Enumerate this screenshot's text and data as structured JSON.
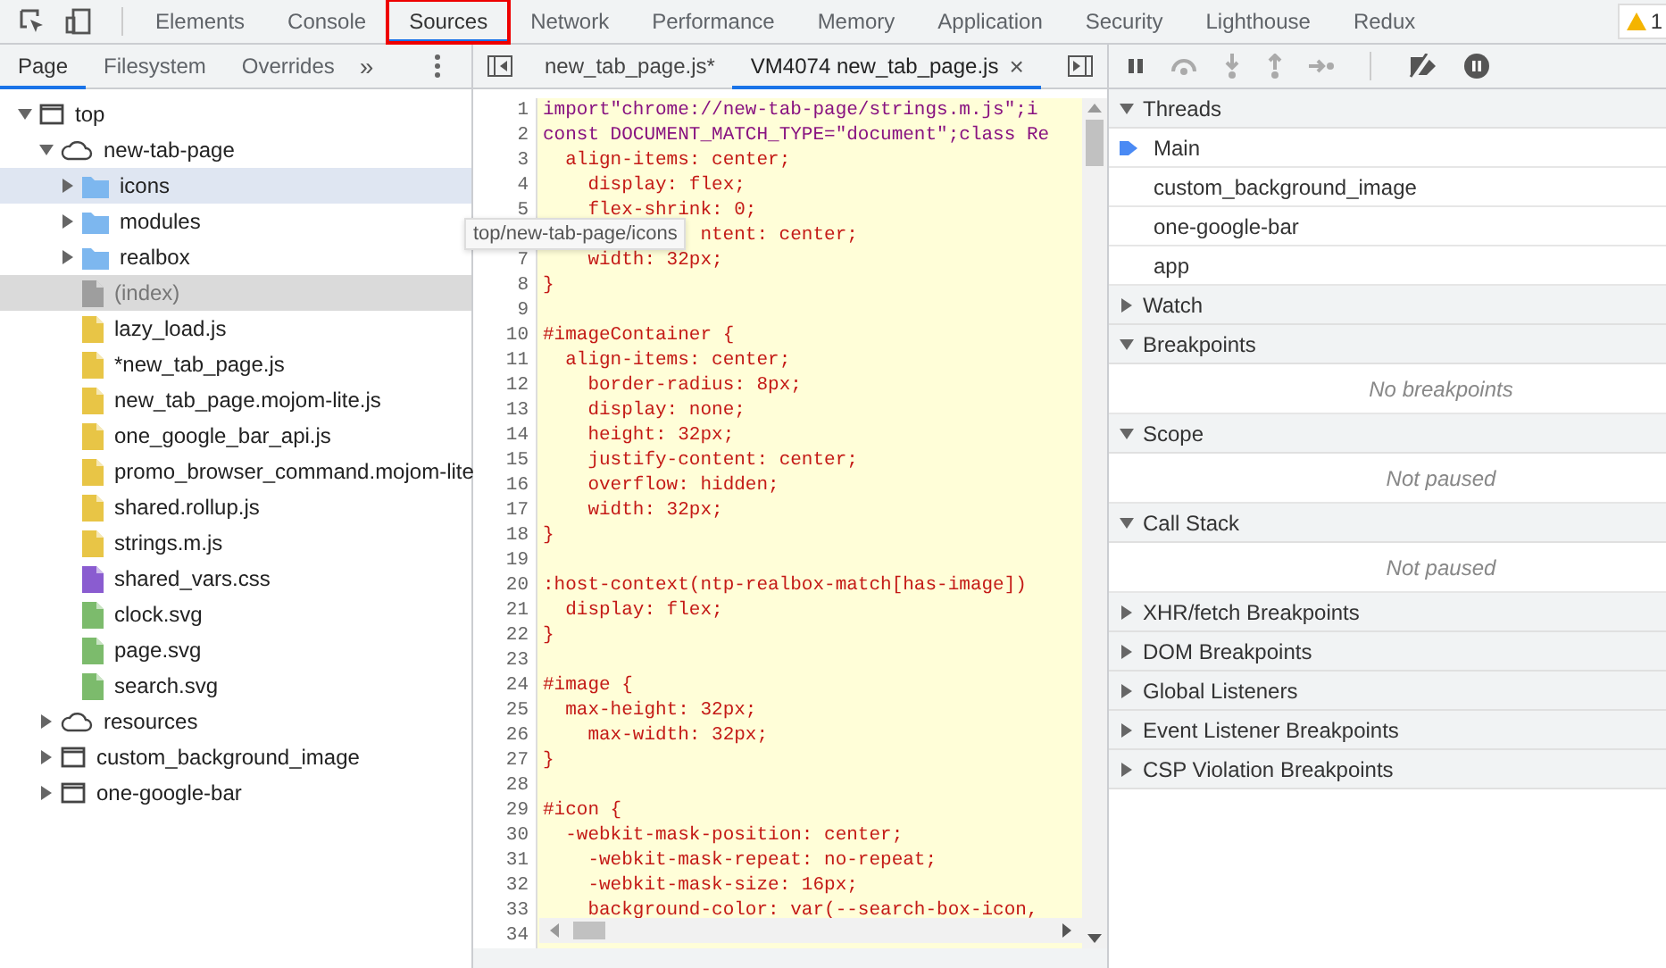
{
  "main_tabs": [
    {
      "label": "Elements",
      "selected": false,
      "highlighted": false
    },
    {
      "label": "Console",
      "selected": false,
      "highlighted": false
    },
    {
      "label": "Sources",
      "selected": true,
      "highlighted": true
    },
    {
      "label": "Network",
      "selected": false,
      "highlighted": false
    },
    {
      "label": "Performance",
      "selected": false,
      "highlighted": false
    },
    {
      "label": "Memory",
      "selected": false,
      "highlighted": false
    },
    {
      "label": "Application",
      "selected": false,
      "highlighted": false
    },
    {
      "label": "Security",
      "selected": false,
      "highlighted": false
    },
    {
      "label": "Lighthouse",
      "selected": false,
      "highlighted": false
    },
    {
      "label": "Redux",
      "selected": false,
      "highlighted": false
    }
  ],
  "warning_count": "1",
  "navigator": {
    "tabs": [
      {
        "label": "Page",
        "selected": true
      },
      {
        "label": "Filesystem",
        "selected": false
      },
      {
        "label": "Overrides",
        "selected": false
      }
    ],
    "more": "»",
    "tree": [
      {
        "label": "top",
        "kind": "frame",
        "expanded": true,
        "selected": false,
        "hovered": false,
        "children": [
          {
            "label": "new-tab-page",
            "kind": "cloud",
            "expanded": true,
            "selected": false,
            "hovered": false,
            "children": [
              {
                "label": "icons",
                "kind": "folder",
                "expanded": false,
                "selected": true,
                "hovered": false
              },
              {
                "label": "modules",
                "kind": "folder",
                "expanded": false,
                "selected": false,
                "hovered": false
              },
              {
                "label": "realbox",
                "kind": "folder",
                "expanded": false,
                "selected": false,
                "hovered": false
              },
              {
                "label": "(index)",
                "kind": "doc",
                "selected": false,
                "hovered": true
              },
              {
                "label": "lazy_load.js",
                "kind": "script",
                "selected": false,
                "hovered": false
              },
              {
                "label": "*new_tab_page.js",
                "kind": "script",
                "selected": false,
                "hovered": false
              },
              {
                "label": "new_tab_page.mojom-lite.js",
                "kind": "script",
                "selected": false,
                "hovered": false
              },
              {
                "label": "one_google_bar_api.js",
                "kind": "script",
                "selected": false,
                "hovered": false
              },
              {
                "label": "promo_browser_command.mojom-lite",
                "kind": "script",
                "selected": false,
                "hovered": false
              },
              {
                "label": "shared.rollup.js",
                "kind": "script",
                "selected": false,
                "hovered": false
              },
              {
                "label": "strings.m.js",
                "kind": "script",
                "selected": false,
                "hovered": false
              },
              {
                "label": "shared_vars.css",
                "kind": "stylesheet",
                "selected": false,
                "hovered": false
              },
              {
                "label": "clock.svg",
                "kind": "image",
                "selected": false,
                "hovered": false
              },
              {
                "label": "page.svg",
                "kind": "image",
                "selected": false,
                "hovered": false
              },
              {
                "label": "search.svg",
                "kind": "image",
                "selected": false,
                "hovered": false
              }
            ]
          },
          {
            "label": "resources",
            "kind": "cloud",
            "expanded": false,
            "selected": false,
            "hovered": false
          },
          {
            "label": "custom_background_image",
            "kind": "frame",
            "expanded": false,
            "selected": false,
            "hovered": false
          },
          {
            "label": "one-google-bar",
            "kind": "frame",
            "expanded": false,
            "selected": false,
            "hovered": false
          }
        ]
      }
    ]
  },
  "tooltip": "top/new-tab-page/icons",
  "editor": {
    "tabs": [
      {
        "label": "new_tab_page.js*",
        "selected": false,
        "closable": false
      },
      {
        "label": "VM4074 new_tab_page.js",
        "selected": true,
        "closable": true
      }
    ],
    "close_glyph": "×",
    "lines": [
      {
        "number": "1",
        "kind": "js",
        "text": "import\"chrome://new-tab-page/strings.m.js\";i"
      },
      {
        "number": "2",
        "kind": "js",
        "text": "const DOCUMENT_MATCH_TYPE=\"document\";class Re"
      },
      {
        "number": "3",
        "kind": "css",
        "text": "  align-items: center;"
      },
      {
        "number": "4",
        "kind": "css",
        "text": "    display: flex;"
      },
      {
        "number": "5",
        "kind": "css",
        "text": "    flex-shrink: 0;"
      },
      {
        "kind": "covered",
        "text": "ntent: center;"
      },
      {
        "number": "7",
        "kind": "css",
        "text": "    width: 32px;"
      },
      {
        "number": "8",
        "kind": "css",
        "text": "}"
      },
      {
        "number": "9",
        "kind": "blank"
      },
      {
        "number": "10",
        "kind": "css",
        "text": "#imageContainer {"
      },
      {
        "number": "11",
        "kind": "css",
        "text": "  align-items: center;"
      },
      {
        "number": "12",
        "kind": "css",
        "text": "    border-radius: 8px;"
      },
      {
        "number": "13",
        "kind": "css",
        "text": "    display: none;"
      },
      {
        "number": "14",
        "kind": "css",
        "text": "    height: 32px;"
      },
      {
        "number": "15",
        "kind": "css",
        "text": "    justify-content: center;"
      },
      {
        "number": "16",
        "kind": "css",
        "text": "    overflow: hidden;"
      },
      {
        "number": "17",
        "kind": "css",
        "text": "    width: 32px;"
      },
      {
        "number": "18",
        "kind": "css",
        "text": "}"
      },
      {
        "number": "19",
        "kind": "blank"
      },
      {
        "number": "20",
        "kind": "css",
        "text": ":host-context(ntp-realbox-match[has-image])"
      },
      {
        "number": "21",
        "kind": "css",
        "text": "  display: flex;"
      },
      {
        "number": "22",
        "kind": "css",
        "text": "}"
      },
      {
        "number": "23",
        "kind": "blank"
      },
      {
        "number": "24",
        "kind": "css",
        "text": "#image {"
      },
      {
        "number": "25",
        "kind": "css",
        "text": "  max-height: 32px;"
      },
      {
        "number": "26",
        "kind": "css",
        "text": "    max-width: 32px;"
      },
      {
        "number": "27",
        "kind": "css",
        "text": "}"
      },
      {
        "number": "28",
        "kind": "blank"
      },
      {
        "number": "29",
        "kind": "css",
        "text": "#icon {"
      },
      {
        "number": "30",
        "kind": "css",
        "text": "  -webkit-mask-position: center;"
      },
      {
        "number": "31",
        "kind": "css",
        "text": "    -webkit-mask-repeat: no-repeat;"
      },
      {
        "number": "32",
        "kind": "css",
        "text": "    -webkit-mask-size: 16px;"
      },
      {
        "number": "33",
        "kind": "css",
        "text": "    background-color: var(--search-box-icon,"
      },
      {
        "number": "34",
        "kind": "blank"
      }
    ]
  },
  "debugger": {
    "sections": [
      {
        "title": "Threads",
        "expanded": true,
        "items": [
          {
            "label": "Main",
            "current": true
          },
          {
            "label": "custom_background_image",
            "current": false
          },
          {
            "label": "one-google-bar",
            "current": false
          },
          {
            "label": "app",
            "current": false
          }
        ]
      },
      {
        "title": "Watch",
        "expanded": false
      },
      {
        "title": "Breakpoints",
        "expanded": true,
        "message": "No breakpoints"
      },
      {
        "title": "Scope",
        "expanded": true,
        "message": "Not paused"
      },
      {
        "title": "Call Stack",
        "expanded": true,
        "message": "Not paused"
      },
      {
        "title": "XHR/fetch Breakpoints",
        "expanded": false
      },
      {
        "title": "DOM Breakpoints",
        "expanded": false
      },
      {
        "title": "Global Listeners",
        "expanded": false
      },
      {
        "title": "Event Listener Breakpoints",
        "expanded": false
      },
      {
        "title": "CSP Violation Breakpoints",
        "expanded": false
      }
    ]
  }
}
